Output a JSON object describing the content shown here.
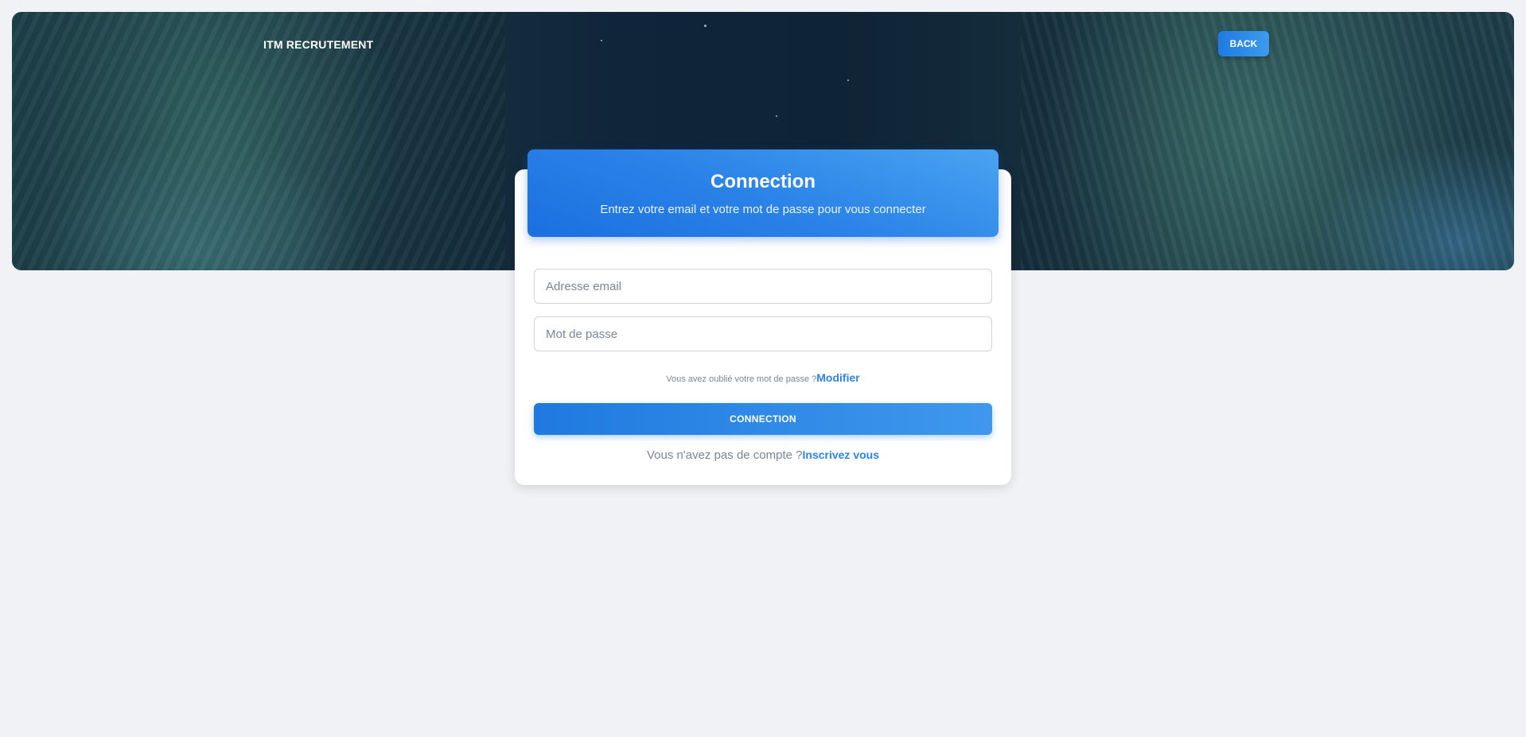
{
  "header": {
    "brand": "ITM RECRUTEMENT",
    "back_label": "BACK"
  },
  "login_card": {
    "title": "Connection",
    "subtitle": "Entrez votre email et votre mot de passe pour vous connecter",
    "email_placeholder": "Adresse email",
    "password_placeholder": "Mot de passe",
    "forgot_text": "Vous avez oublié votre mot de passe ?",
    "forgot_link": "Modifier",
    "submit_label": "CONNECTION",
    "signup_text": "Vous n'avez pas de compte ?",
    "signup_link": "Inscrivez vous"
  },
  "colors": {
    "accent": "#2b84e8",
    "page_background": "#f0f2f5"
  }
}
